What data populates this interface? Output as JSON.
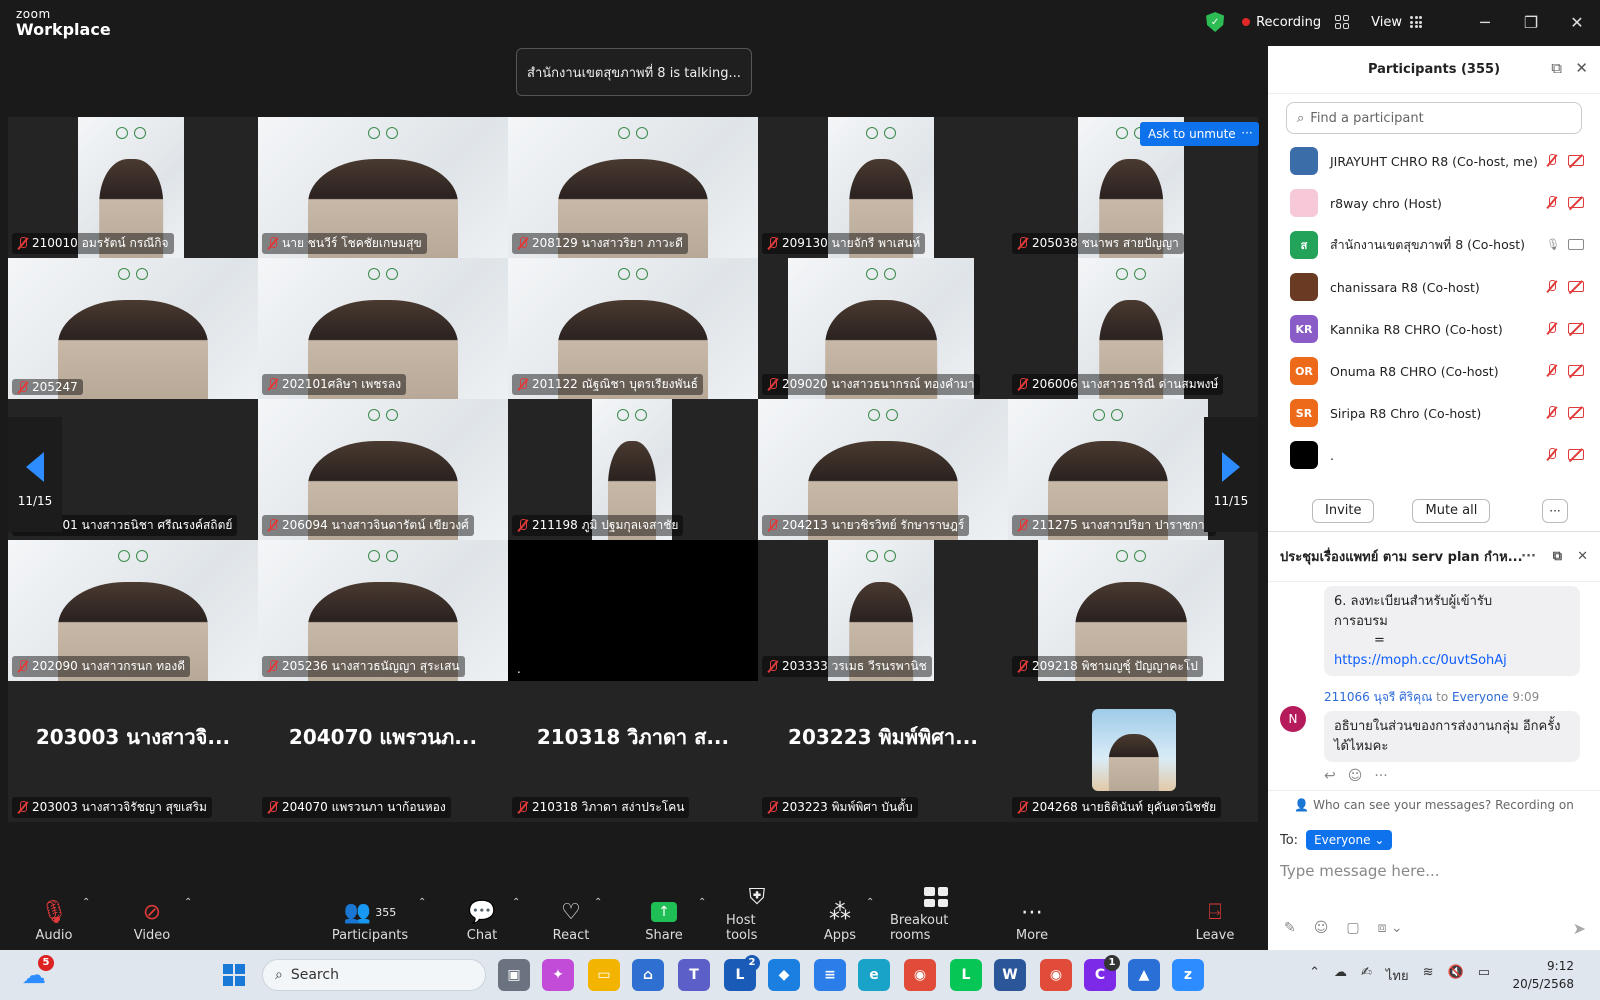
{
  "app": {
    "brand_top": "zoom",
    "brand_name": "Workplace"
  },
  "titlebar": {
    "recording_label": "Recording",
    "view_label": "View"
  },
  "talking_banner": "สำนักงานเขตสุขภาพที่ 8 is talking...",
  "gallery": {
    "page_left": "11/15",
    "page_right": "11/15",
    "ask_unmute": "Ask to unmute",
    "tiles": [
      {
        "name": "210010 อมรรัตน์ กรณีกิจ"
      },
      {
        "name": "นาย ชนวีร์ โชคชัยเกษมสุข"
      },
      {
        "name": "208129 นางสาวริยา ภาวะดี"
      },
      {
        "name": "209130 นายจักรี พาเสนห์"
      },
      {
        "name": "205038 ชนาพร สายปัญญา"
      },
      {
        "name": "205247"
      },
      {
        "name": "202101ศลิษา เพชรลง"
      },
      {
        "name": "201122 ณัฐณิชา บุตรเรียงพันธ์"
      },
      {
        "name": "209020 นางสาวธนากรณ์ ทองคำมา"
      },
      {
        "name": "206006 นางสาวธาริณี ด่านสมพงษ์"
      },
      {
        "name": "203201 นางสาวธนิชา ศรีณรงค์สถิตย์"
      },
      {
        "name": "206094 นางสาวจินดารัตน์ เขียวงศ์"
      },
      {
        "name": "211198 ภูมิ ปฐมกุลเจสาชัย"
      },
      {
        "name": "204213 นายวชิรวิทย์ รักษาราษฎร์"
      },
      {
        "name": "211275 นางสาวปริยา ปาราชการ"
      },
      {
        "name": "202090 นางสาวกรนก ทองดี"
      },
      {
        "name": "205236 นางสาวธนัญญา สุระเสน"
      },
      {
        "name": "."
      },
      {
        "name": "203333 วรเมธ วีรนรพานิช"
      },
      {
        "name": "209218 พิชามญชุ์ ปัญญาคะโป"
      },
      {
        "name": "203003 นางสาวจิรัชญา สุขเสริม",
        "big": "203003 นางสาวจิ..."
      },
      {
        "name": "204070 แพรวนภา นาก้อนหอง",
        "big": "204070 แพรวนภ..."
      },
      {
        "name": "210318 วิภาดา สง่าประโคน",
        "big": "210318 วิภาดา ส..."
      },
      {
        "name": "203223 พิมพ์พิศา บันตั้บ",
        "big": "203223 พิมพ์พิศา..."
      },
      {
        "name": "204268 นายธิตินันท์ ยุคันตวนิชชัย"
      }
    ]
  },
  "toolbar": {
    "audio": "Audio",
    "video": "Video",
    "participants": "Participants",
    "participants_count": "355",
    "chat": "Chat",
    "react": "React",
    "share": "Share",
    "host_tools": "Host tools",
    "apps": "Apps",
    "breakout": "Breakout rooms",
    "more": "More",
    "leave": "Leave"
  },
  "participants_panel": {
    "title": "Participants (355)",
    "search_placeholder": "Find a participant",
    "invite": "Invite",
    "mute_all": "Mute all",
    "rows": [
      {
        "name": "JIRAYUHT CHRO R8 (Co-host, me)",
        "initials": "",
        "color": "#3b6ea8"
      },
      {
        "name": "r8way chro (Host)",
        "initials": "",
        "color": "#f7c9d8"
      },
      {
        "name": "สำนักงานเขตสุขภาพที่ 8 (Co-host)",
        "initials": "ส",
        "color": "#23a35a"
      },
      {
        "name": "chanissara R8 (Co-host)",
        "initials": "",
        "color": "#6b3a22"
      },
      {
        "name": "Kannika R8 CHRO (Co-host)",
        "initials": "KR",
        "color": "#8a5cc7"
      },
      {
        "name": "Onuma R8 CHRO (Co-host)",
        "initials": "OR",
        "color": "#ec6a1a"
      },
      {
        "name": "Siripa R8 Chro (Co-host)",
        "initials": "SR",
        "color": "#ec6a1a"
      },
      {
        "name": ".",
        "initials": "",
        "color": "#000000"
      }
    ]
  },
  "chat_panel": {
    "title": "ประชุมเรื่องแพทย์ ตาม serv plan กำห...",
    "msg1_line1": "6. ลงทะเบียนสำหรับผู้เข้ารับ",
    "msg1_line2": "การอบรม",
    "msg1_line3": "=",
    "msg1_link": "https://moph.cc/0uvtSohAj",
    "sender": "211066 นุจรี ศิริคุณ",
    "to_word": "to",
    "to_target": "Everyone",
    "time": "9:09",
    "avatar": "N",
    "msg2": "อธิบายในส่วนของการส่งงานกลุ่ม อีกครั้งได้ไหมคะ",
    "visibility": "Who can see your messages? Recording on",
    "to_label": "To:",
    "to_value": "Everyone",
    "placeholder": "Type message here..."
  },
  "taskbar": {
    "search": "Search",
    "time": "9:12",
    "date": "20/5/2568",
    "lang": "ไทย",
    "weather_badge": "5",
    "teams_badge": "2",
    "canva_badge": "1"
  }
}
